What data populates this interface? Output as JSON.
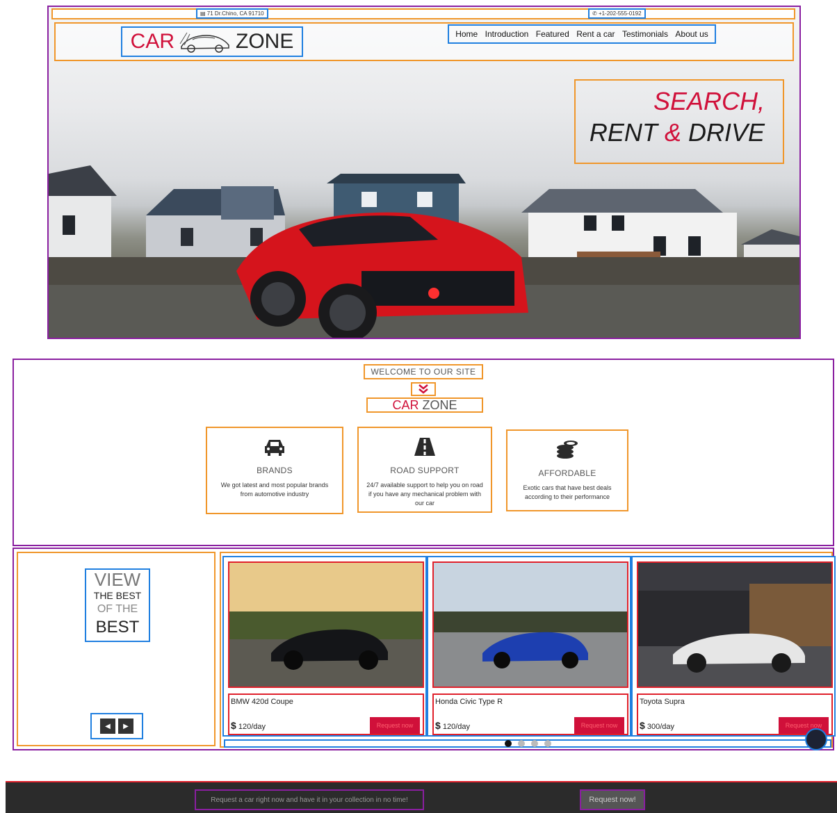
{
  "colors": {
    "accent": "#d0103a",
    "dark": "#2b2b2b",
    "outline_orange": "#f0962a",
    "outline_blue": "#1f7fe0",
    "outline_purple": "#8a1fa0"
  },
  "topbar": {
    "address_icon": "map-icon",
    "address": "71 Dr.Chino, CA 91710",
    "phone_icon": "phone-icon",
    "phone": "+1-202-555-0192"
  },
  "brand": {
    "part1": "CAR",
    "part2": "ZONE",
    "emblem": "sports-car-icon"
  },
  "nav": {
    "items": [
      "Home",
      "Introduction",
      "Featured",
      "Rent a car",
      "Testimonials",
      "About us"
    ]
  },
  "hero": {
    "line1": "SEARCH,",
    "line2a": "RENT",
    "line2b": "&",
    "line2c": "DRIVE"
  },
  "welcome": {
    "label": "WELCOME TO OUR SITE",
    "chevron_icon": "double-chevron-down-icon",
    "features": [
      {
        "icon": "car-icon",
        "title": "BRANDS",
        "desc": "We got latest and most popular brands from automotive industry"
      },
      {
        "icon": "road-icon",
        "title": "ROAD SUPPORT",
        "desc": "24/7 available support to help you on road if you have any mechanical problem with our car"
      },
      {
        "icon": "coins-icon",
        "title": "AFFORDABLE",
        "desc": "Exotic cars that have best deals according to their performance"
      }
    ]
  },
  "showcase": {
    "line1": "VIEW",
    "line2": "THE BEST",
    "line3": "OF THE",
    "line4": "BEST",
    "prev_icon": "caret-left-icon",
    "next_icon": "caret-right-icon",
    "cars": [
      {
        "name": "BMW 420d Coupe",
        "currency": "$",
        "price": "120/day",
        "cta": "Request now"
      },
      {
        "name": "Honda Civic Type R",
        "currency": "$",
        "price": "120/day",
        "cta": "Request now"
      },
      {
        "name": "Toyota Supra",
        "currency": "$",
        "price": "300/day",
        "cta": "Request now"
      }
    ],
    "dots": 4,
    "active_dot": 1
  },
  "cta": {
    "text": "Request a car right now and have it in your collection in no time!",
    "button": "Request now!"
  }
}
